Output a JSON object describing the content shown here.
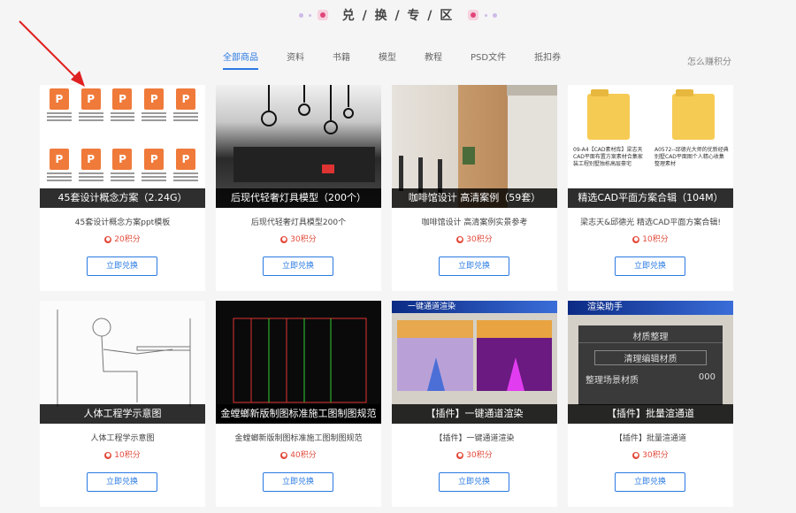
{
  "header": {
    "title": "兑 / 换 / 专 / 区"
  },
  "tabs": [
    "全部商品",
    "资料",
    "书籍",
    "模型",
    "教程",
    "PSD文件",
    "抵扣券"
  ],
  "how_link": "怎么赚积分",
  "cards": [
    {
      "caption": "45套设计概念方案（2.24G）",
      "name": "45套设计概念方案ppt模板",
      "points": "20积分",
      "button": "立即兑换"
    },
    {
      "caption": "后现代轻奢灯具模型（200个）",
      "name": "后现代轻奢灯具模型200个",
      "points": "30积分",
      "button": "立即兑换"
    },
    {
      "caption": "咖啡馆设计 高清案例（59套）",
      "name": "咖啡馆设计 高清案例实景参考",
      "points": "30积分",
      "button": "立即兑换"
    },
    {
      "caption": "精选CAD平面方案合辑（104M）",
      "name": "梁志天&邱德光 精选CAD平面方案合辑!",
      "points": "10积分",
      "button": "立即兑换"
    },
    {
      "caption": "人体工程学示意图",
      "name": "人体工程学示意图",
      "points": "10积分",
      "button": "立即兑换"
    },
    {
      "caption": "金螳螂新版制图标准施工图制图规范",
      "name": "金螳螂新版制图标准施工图制图规范",
      "points": "40积分",
      "button": "立即兑换"
    },
    {
      "caption": "【插件】一键通道渲染",
      "name": "【插件】一键通道渲染",
      "points": "30积分",
      "button": "立即兑换"
    },
    {
      "caption": "【插件】批量渲通道",
      "name": "【插件】批量渲通道",
      "points": "30积分",
      "button": "立即兑换"
    }
  ],
  "thumb_texts": {
    "files_letter": "P",
    "folders": [
      "09-A4【CAD素材库】梁志天CAD平面布置方案素材合集家装工程别墅独栋高层豪宅",
      "A0572--邱德光大师的优新经典别墅CAD平面图个人精心收集整理素材"
    ],
    "plug_title": "一键通道渲染",
    "render_title": "渲染助手",
    "render_menu": [
      "材质整理",
      "清理编辑材质",
      "整理场景材质",
      "000"
    ]
  },
  "colors": {
    "accent": "#2a7ae2",
    "price": "#e24a3b"
  }
}
